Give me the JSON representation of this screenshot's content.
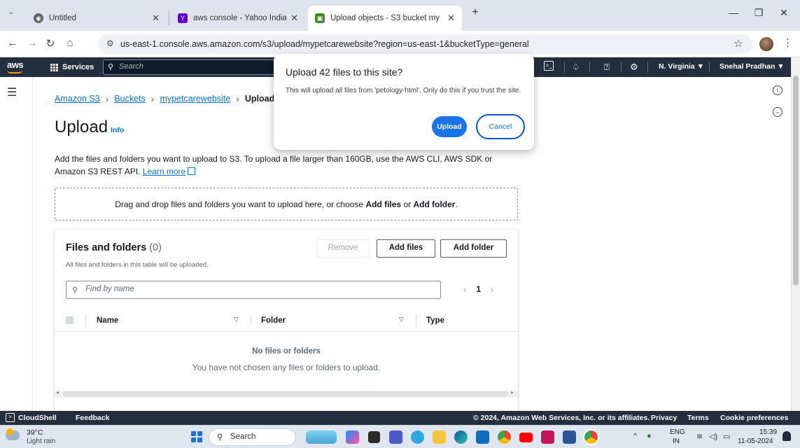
{
  "browser": {
    "tabs": [
      {
        "title": "Untitled",
        "active": false
      },
      {
        "title": "aws console - Yahoo India Sear",
        "active": false
      },
      {
        "title": "Upload objects - S3 bucket my",
        "active": true
      }
    ],
    "new_tab": "+",
    "url": "us-east-1.console.aws.amazon.com/s3/upload/mypetcarewebsite?region=us-east-1&bucketType=general"
  },
  "aws_header": {
    "logo": "aws",
    "services": "Services",
    "search_placeholder": "Search",
    "region": "N. Virginia ▼",
    "user": "Snehal Pradhan ▼"
  },
  "breadcrumbs": [
    {
      "label": "Amazon S3",
      "link": true
    },
    {
      "label": "Buckets",
      "link": true
    },
    {
      "label": "mypetcarewebsite",
      "link": true
    },
    {
      "label": "Upload",
      "link": false
    }
  ],
  "page": {
    "title": "Upload",
    "info": "Info",
    "description": "Add the files and folders you want to upload to S3. To upload a file larger than 160GB, use the AWS CLI, AWS SDK or Amazon S3 REST API.",
    "learn_more": "Learn more",
    "dropzone_text_1": "Drag and drop files and folders you want to upload here, or choose ",
    "dropzone_add_files": "Add files",
    "dropzone_or": " or ",
    "dropzone_add_folder": "Add folder",
    "dropzone_end": "."
  },
  "files_panel": {
    "title": "Files and folders",
    "count": "(0)",
    "subtitle": "All files and folders in this table will be uploaded.",
    "remove_btn": "Remove",
    "add_files_btn": "Add files",
    "add_folder_btn": "Add folder",
    "find_placeholder": "Find by name",
    "page_number": "1",
    "columns": [
      "Name",
      "Folder",
      "Type"
    ],
    "empty_title": "No files or folders",
    "empty_subtitle": "You have not chosen any files or folders to upload."
  },
  "dialog": {
    "title": "Upload 42 files to this site?",
    "message": "This will upload all files from 'petology-html'. Only do this if you trust the site.",
    "upload_btn": "Upload",
    "cancel_btn": "Cancel"
  },
  "aws_footer": {
    "cloudshell": "CloudShell",
    "feedback": "Feedback",
    "copyright": "© 2024, Amazon Web Services, Inc. or its affiliates.",
    "privacy": "Privacy",
    "terms": "Terms",
    "cookies": "Cookie preferences"
  },
  "taskbar": {
    "temp": "39°C",
    "weather": "Light rain",
    "search": "Search",
    "lang_1": "ENG",
    "lang_2": "IN",
    "time": "15:39",
    "date": "11-05-2024"
  },
  "colors": {
    "aws_nav": "#232f3e",
    "aws_orange": "#ff9900",
    "link_blue": "#0972d3",
    "dialog_primary": "#1a73e8"
  }
}
